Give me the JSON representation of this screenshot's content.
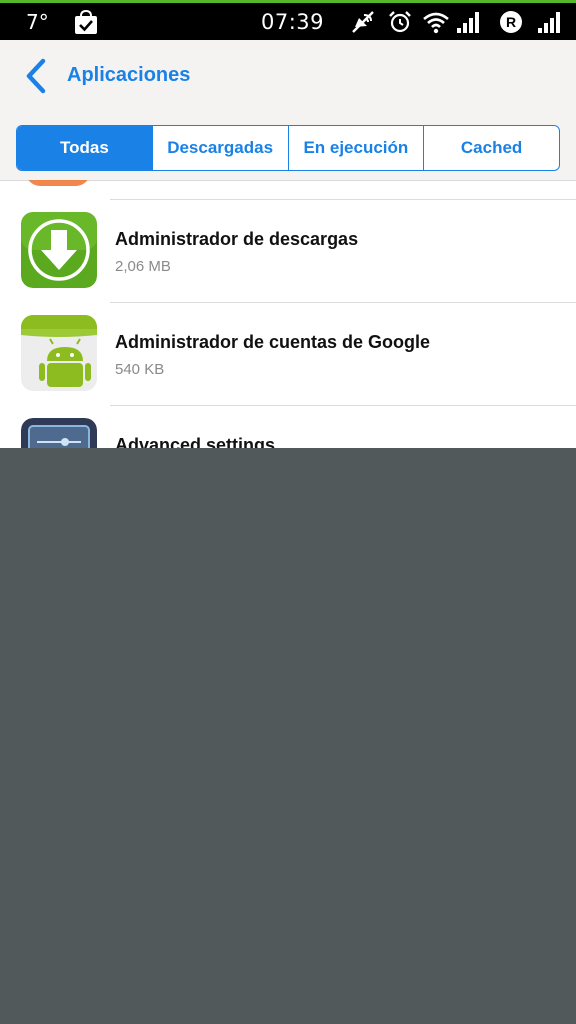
{
  "status_bar": {
    "temperature": "7°",
    "time": "07:39",
    "icons": [
      "shopping-bag-check-icon",
      "notifications-muted-icon",
      "alarm-icon",
      "wifi-icon",
      "signal-icon",
      "roaming-r-icon",
      "signal-icon"
    ],
    "roaming_label": "R"
  },
  "header": {
    "title": "Aplicaciones",
    "back_icon": "chevron-left-icon"
  },
  "tabs": [
    {
      "label": "Todas",
      "active": true
    },
    {
      "label": "Descargadas",
      "active": false
    },
    {
      "label": "En ejecución",
      "active": false
    },
    {
      "label": "Cached",
      "active": false
    }
  ],
  "apps": [
    {
      "name": "Administrador de descargas",
      "size": "2,06 MB",
      "icon": "download-arrow-icon"
    },
    {
      "name": "Administrador de cuentas de Google",
      "size": "540 KB",
      "icon": "android-robot-icon"
    },
    {
      "name": "Advanced settings",
      "size": "",
      "icon": "settings-sliders-icon"
    }
  ],
  "colors": {
    "accent": "#1a82e6",
    "header_bg": "#f4f3f1",
    "status_bar_bg": "#000000",
    "status_bar_line": "#55b82b",
    "overlay_gray": "#51595b",
    "download_icon_green": "#5aa91f",
    "android_green": "#8cbc1f"
  }
}
